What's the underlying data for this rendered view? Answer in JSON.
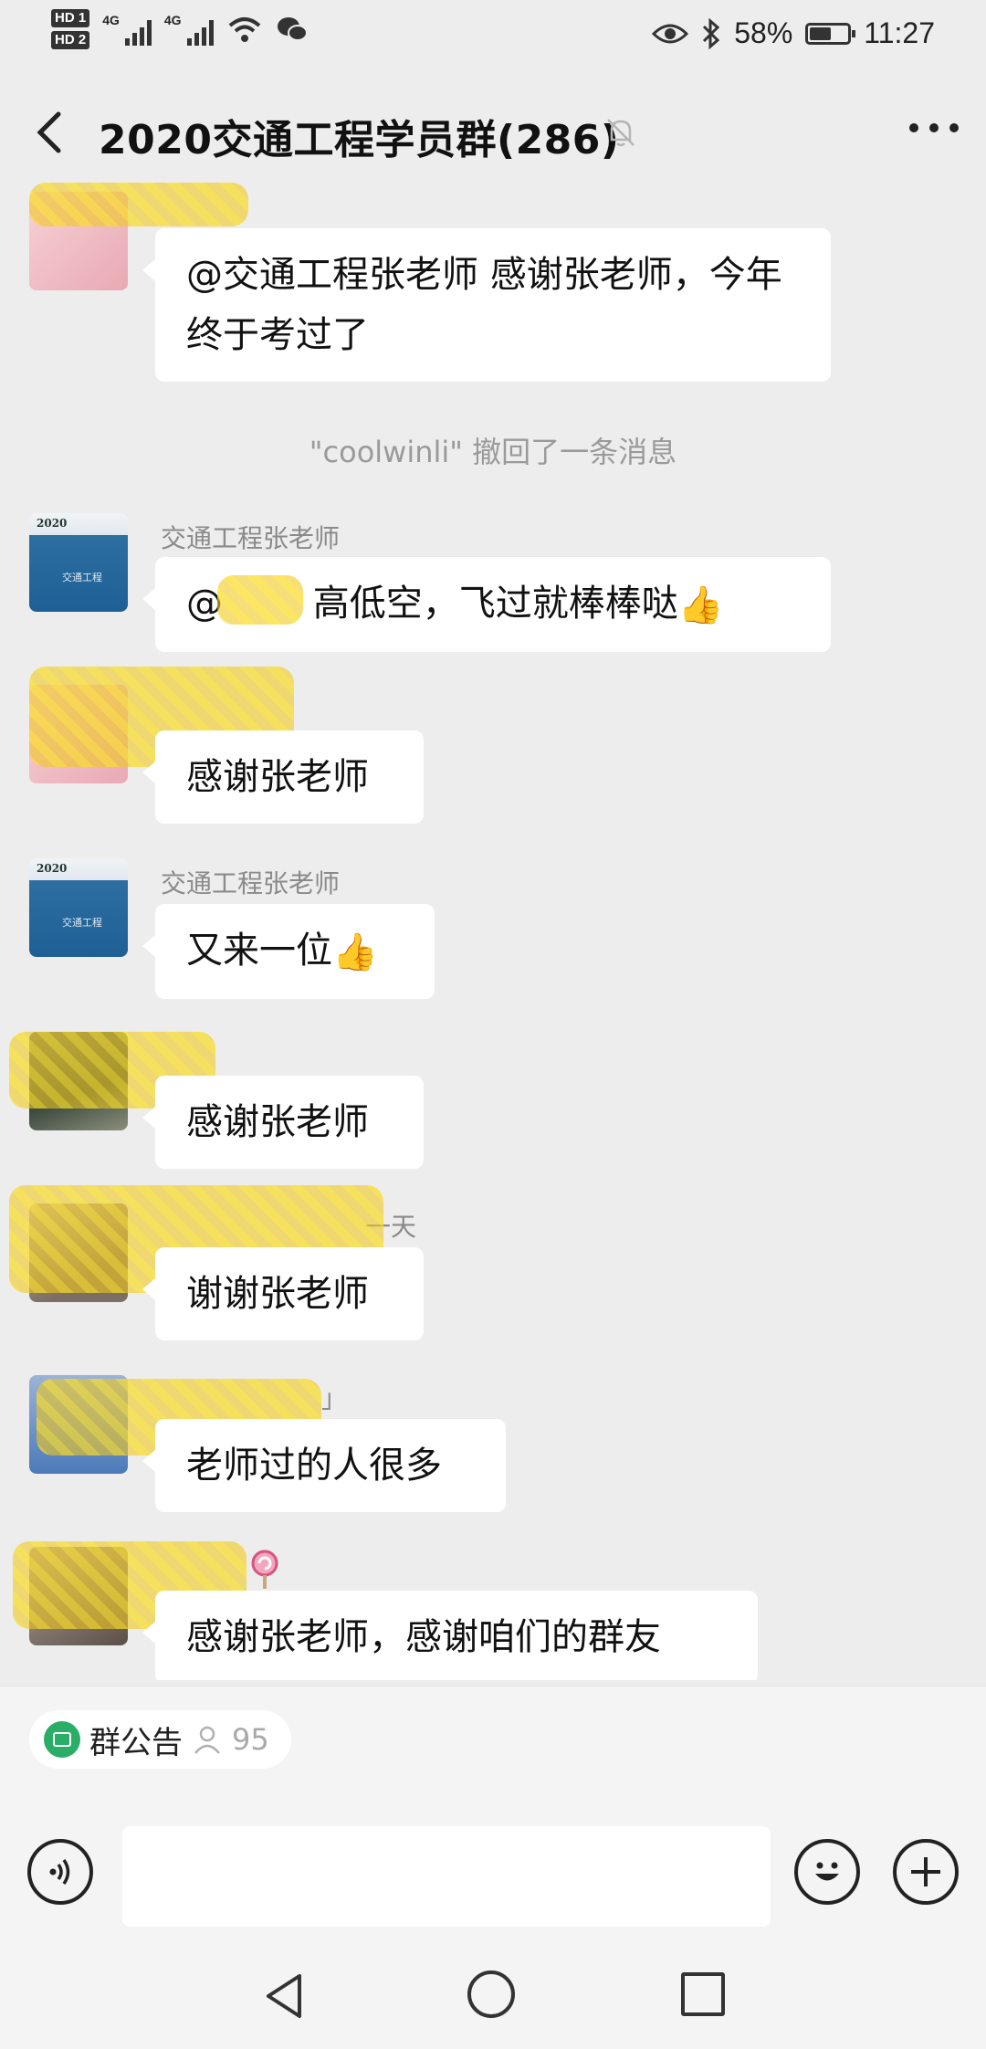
{
  "status_bar": {
    "hd1": "HD 1",
    "hd2": "HD 2",
    "net1": "4G",
    "net2": "4G",
    "battery": "58%",
    "battery_level": 0.58,
    "time": "11:27"
  },
  "header": {
    "title": "2020交通工程学员群(286)",
    "icons": [
      "back-icon",
      "muted-bell-icon",
      "more-icon"
    ]
  },
  "messages": [
    {
      "type": "bubble",
      "avatar": "pink",
      "text": "@交通工程张老师 感谢张老师，今年终于考过了"
    },
    {
      "type": "recall",
      "text": "\"coolwinli\" 撤回了一条消息"
    },
    {
      "type": "bubble",
      "avatar": "book",
      "nickname": "交通工程张老师",
      "avatar_text": "2020",
      "avatar_label": "交通工程",
      "text": "@",
      "text_after": "  高低空，飞过就棒棒哒",
      "emoji": "👍"
    },
    {
      "type": "bubble",
      "avatar": "pink",
      "text": "感谢张老师"
    },
    {
      "type": "bubble",
      "avatar": "book",
      "nickname": "交通工程张老师",
      "avatar_text": "2020",
      "avatar_label": "交通工程",
      "text": "又来一位",
      "emoji": "👍"
    },
    {
      "type": "bubble",
      "avatar": "photo",
      "text": "感谢张老师"
    },
    {
      "type": "bubble",
      "avatar": "face",
      "nickname_tail": "一天",
      "text": "谢谢张老师"
    },
    {
      "type": "bubble",
      "avatar": "blue",
      "nickname_tail": "」",
      "text": "老师过的人很多"
    },
    {
      "type": "bubble",
      "avatar": "dark",
      "text": "感谢张老师，感谢咱们的群友"
    }
  ],
  "notice": {
    "label": "群公告",
    "count": "95"
  },
  "input": {
    "placeholder": ""
  }
}
